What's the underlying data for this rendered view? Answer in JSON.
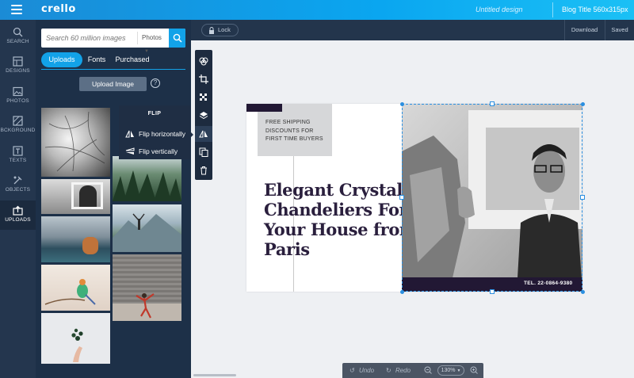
{
  "topbar": {
    "logo": "crello",
    "doc_title": "Untitled design",
    "format_label": "Blog Title 560x315px"
  },
  "rail": [
    {
      "label": "SEARCH",
      "icon": "search-icon"
    },
    {
      "label": "DESIGNS",
      "icon": "designs-icon"
    },
    {
      "label": "PHOTOS",
      "icon": "photos-icon"
    },
    {
      "label": "BCKGROUND",
      "icon": "background-icon"
    },
    {
      "label": "TEXTS",
      "icon": "texts-icon"
    },
    {
      "label": "OBJECTS",
      "icon": "objects-icon"
    },
    {
      "label": "UPLOADS",
      "icon": "uploads-icon",
      "active": true
    }
  ],
  "panel": {
    "search_placeholder": "Search 60 million images",
    "search_type": "Photos",
    "tabs": [
      {
        "label": "Uploads",
        "active": true
      },
      {
        "label": "Fonts"
      },
      {
        "label": "Purchased"
      }
    ],
    "upload_button": "Upload Image",
    "help": "?"
  },
  "flip_menu": {
    "title": "FLIP",
    "horizontal": "Flip horizontally",
    "vertical": "Flip vertically"
  },
  "subbar": {
    "lock": "Lock",
    "download": "Download",
    "saved": "Saved"
  },
  "canvas": {
    "promo_line1": "FREE SHIPPING",
    "promo_line2": "DISCOUNTS FOR",
    "promo_line3": "FIRST TIME BUYERS",
    "headline_line1": "Elegant Crystal",
    "headline_line2": "Chandeliers For",
    "headline_line3": "Your House from",
    "headline_line4": "Paris",
    "tel": "TEL. 22-0864-9380"
  },
  "bottombar": {
    "undo": "Undo",
    "redo": "Redo",
    "zoom": "130%"
  },
  "colors": {
    "accent": "#12a2e8",
    "rail_bg": "#24364e",
    "panel_bg": "#1d3048",
    "headline": "#2a1f3d"
  }
}
